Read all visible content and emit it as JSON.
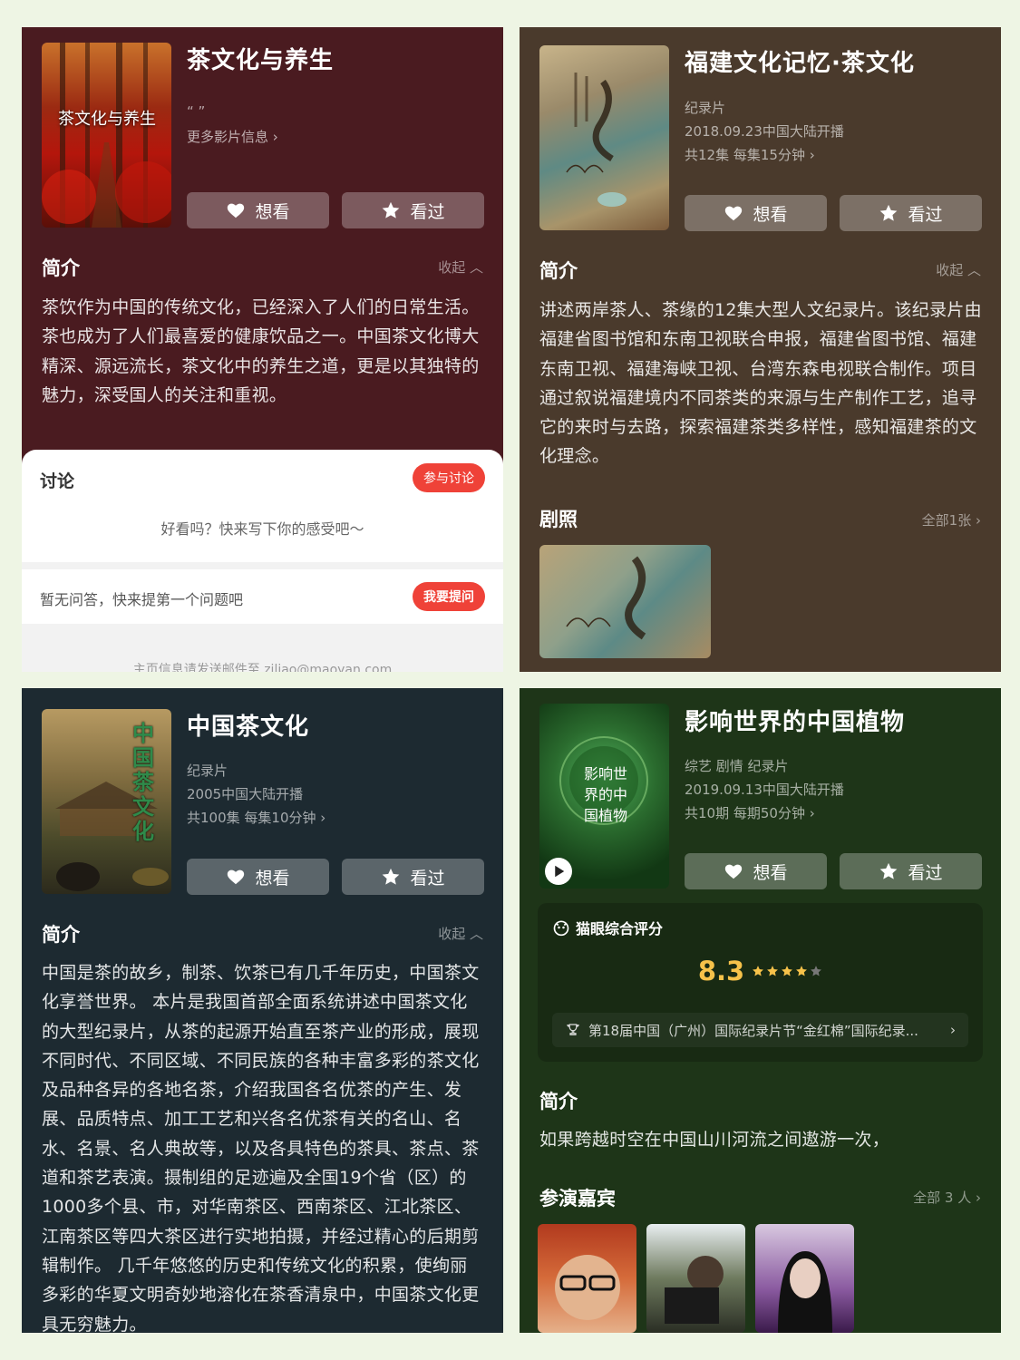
{
  "panel1": {
    "poster_text": "茶文化与养生",
    "title": "茶文化与养生",
    "quote": "“ ”",
    "more_info": "更多影片信息",
    "want_label": "想看",
    "seen_label": "看过",
    "intro_heading": "简介",
    "collapse_label": "收起",
    "intro_text": "茶饮作为中国的传统文化，已经深入了人们的日常生活。茶也成为了人们最喜爱的健康饮品之一。中国茶文化博大精深、源远流长，茶文化中的养生之道，更是以其独特的魅力，深受国人的关注和重视。",
    "discussion_heading": "讨论",
    "join_discussion": "参与讨论",
    "discussion_prompt": "好看吗？快来写下你的感受吧～",
    "qa_empty": "暂无问答，快来提第一个问题吧",
    "ask_button": "我要提问",
    "footer_text": "主页信息请发送邮件至 ziliao@maoyan.com"
  },
  "panel2": {
    "title": "福建文化记忆·茶文化",
    "genre": "纪录片",
    "release": "2018.09.23中国大陆开播",
    "episodes": "共12集 每集15分钟",
    "want_label": "想看",
    "seen_label": "看过",
    "intro_heading": "简介",
    "collapse_label": "收起",
    "intro_text": "讲述两岸茶人、茶缘的12集大型人文纪录片。该纪录片由福建省图书馆和东南卫视联合申报，福建省图书馆、福建东南卫视、福建海峡卫视、台湾东森电视联合制作。项目通过叙说福建境内不同茶类的来源与生产制作工艺，追寻它的来时与去路，探索福建茶类多样性，感知福建茶的文化理念。",
    "stills_heading": "剧照",
    "stills_all": "全部1张"
  },
  "panel3": {
    "poster_text": "中国茶文化",
    "title": "中国茶文化",
    "genre": "纪录片",
    "release": "2005中国大陆开播",
    "episodes": "共100集 每集10分钟",
    "want_label": "想看",
    "seen_label": "看过",
    "intro_heading": "简介",
    "collapse_label": "收起",
    "intro_text": "中国是茶的故乡，制茶、饮茶已有几千年历史，中国茶文化享誉世界。 本片是我国首部全面系统讲述中国茶文化的大型纪录片，从茶的起源开始直至茶产业的形成，展现不同时代、不同区域、不同民族的各种丰富多彩的茶文化及品种各异的各地名茶，介绍我国各名优茶的产生、发展、品质特点、加工工艺和兴各名优茶有关的名山、名水、名景、名人典故等，以及各具特色的茶具、茶点、茶道和茶艺表演。摄制组的足迹遍及全国19个省（区）的1000多个县、市，对华南茶区、西南茶区、江北茶区、江南茶区等四大茶区进行实地拍摄，并经过精心的后期剪辑制作。 几千年悠悠的历史和传统文化的积累，使绚丽多彩的华夏文明奇妙地溶化在茶香清泉中，中国茶文化更具无穷魅力。"
  },
  "panel4": {
    "poster_text": "影响世界的中国植物",
    "title": "影响世界的中国植物",
    "genre": "综艺 剧情 纪录片",
    "release": "2019.09.13中国大陆开播",
    "episodes": "共10期 每期50分钟",
    "want_label": "想看",
    "seen_label": "看过",
    "rating_label": "猫眼综合评分",
    "rating_value": "8.3",
    "rating_stars": 4,
    "award_text": "第18届中国（广州）国际纪录片节“金红棉”国际纪录...",
    "intro_heading": "简介",
    "intro_text": "如果跨越时空在中国山川河流之间遨游一次，",
    "cast_heading": "参演嘉宾",
    "cast_all": "全部 3 人"
  },
  "colors": {
    "accent_red": "#ef4238",
    "rating_yellow": "#f6c24a",
    "panel1_bg": "#4a1b20",
    "panel2_bg": "#4a3a2c",
    "panel3_bg": "#1d2a31",
    "panel4_bg": "#1e3518"
  }
}
